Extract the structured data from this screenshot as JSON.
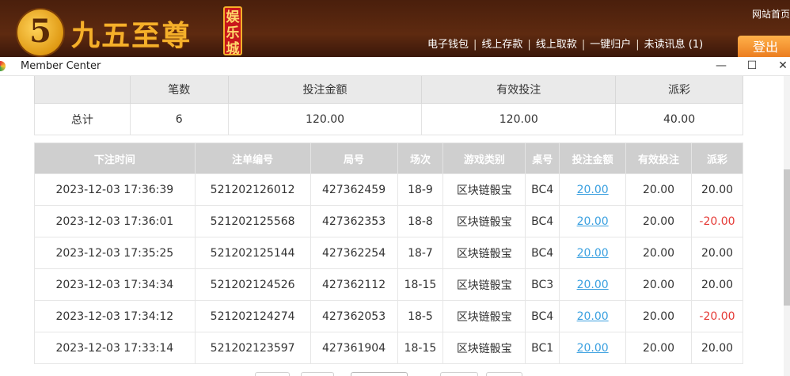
{
  "site": {
    "logo_mark": "5",
    "logo_text": "九五至尊",
    "logo_tag": "娱乐城",
    "home_link": "网站首页",
    "nav": [
      "电子钱包",
      "线上存款",
      "线上取款",
      "一键归户",
      "未读讯息 (1)"
    ],
    "logout": "登出"
  },
  "window": {
    "title": "Member Center",
    "minimize": "—",
    "maximize": "☐",
    "close": "✕"
  },
  "summary": {
    "headers": [
      "",
      "笔数",
      "投注金额",
      "有效投注",
      "派彩"
    ],
    "row": [
      "总计",
      "6",
      "120.00",
      "120.00",
      "40.00"
    ]
  },
  "detail": {
    "headers": [
      "下注时间",
      "注单编号",
      "局号",
      "场次",
      "游戏类别",
      "桌号",
      "投注金额",
      "有效投注",
      "派彩"
    ],
    "rows": [
      [
        "2023-12-03 17:36:39",
        "521202126012",
        "427362459",
        "18-9",
        "区块链骰宝",
        "BC4",
        "20.00",
        "20.00",
        "20.00"
      ],
      [
        "2023-12-03 17:36:01",
        "521202125568",
        "427362353",
        "18-8",
        "区块链骰宝",
        "BC4",
        "20.00",
        "20.00",
        "-20.00"
      ],
      [
        "2023-12-03 17:35:25",
        "521202125144",
        "427362254",
        "18-7",
        "区块链骰宝",
        "BC4",
        "20.00",
        "20.00",
        "20.00"
      ],
      [
        "2023-12-03 17:34:34",
        "521202124526",
        "427362112",
        "18-15",
        "区块链骰宝",
        "BC3",
        "20.00",
        "20.00",
        "20.00"
      ],
      [
        "2023-12-03 17:34:12",
        "521202124274",
        "427362053",
        "18-5",
        "区块链骰宝",
        "BC4",
        "20.00",
        "20.00",
        "-20.00"
      ],
      [
        "2023-12-03 17:33:14",
        "521202123597",
        "427361904",
        "18-15",
        "区块链骰宝",
        "BC1",
        "20.00",
        "20.00",
        "20.00"
      ]
    ]
  },
  "colors": {
    "negative": "#e53935",
    "link": "#3aa0e0",
    "header_bg": "#cfcfcf"
  }
}
